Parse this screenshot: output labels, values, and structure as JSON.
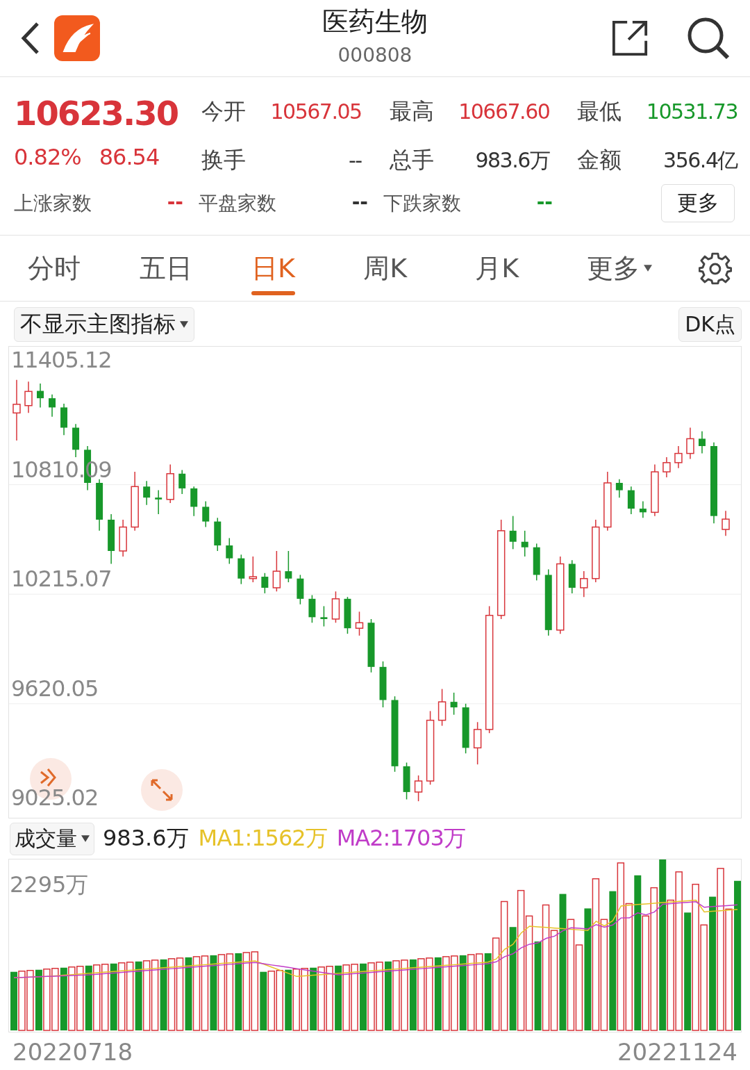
{
  "header": {
    "title": "医药生物",
    "code": "000808"
  },
  "quote": {
    "price": "10623.30",
    "change_pct": "0.82%",
    "change": "86.54",
    "color": "#d8343a",
    "stats": [
      {
        "label": "今开",
        "value": "10567.05",
        "color": "#d8343a"
      },
      {
        "label": "最高",
        "value": "10667.60",
        "color": "#d8343a"
      },
      {
        "label": "最低",
        "value": "10531.73",
        "color": "#17982a"
      },
      {
        "label": "换手",
        "value": "--",
        "color": "#333333"
      },
      {
        "label": "总手",
        "value": "983.6万",
        "color": "#333333"
      },
      {
        "label": "金额",
        "value": "356.4亿",
        "color": "#333333"
      }
    ],
    "breadth": [
      {
        "label": "上涨家数",
        "value": "--",
        "color": "#d8343a"
      },
      {
        "label": "平盘家数",
        "value": "--",
        "color": "#333333"
      },
      {
        "label": "下跌家数",
        "value": "--",
        "color": "#17982a"
      }
    ],
    "more_button": "更多"
  },
  "tabs": [
    {
      "label": "分时",
      "selected": false,
      "caret": false
    },
    {
      "label": "五日",
      "selected": false,
      "caret": false
    },
    {
      "label": "日K",
      "selected": true,
      "caret": false
    },
    {
      "label": "周K",
      "selected": false,
      "caret": false
    },
    {
      "label": "月K",
      "selected": false,
      "caret": false
    },
    {
      "label": "更多",
      "selected": false,
      "caret": true
    }
  ],
  "indicator_select": "不显示主图指标",
  "dk_button": "DK点",
  "price_chart": {
    "chart_data": {
      "type": "candlestick",
      "grid": true,
      "ylim": [
        9000,
        11560
      ],
      "yticks": [
        {
          "value": 11405.12,
          "label": "11405.12"
        },
        {
          "value": 10810.09,
          "label": "10810.09"
        },
        {
          "value": 10215.07,
          "label": "10215.07"
        },
        {
          "value": 9620.05,
          "label": "9620.05"
        },
        {
          "value": 9025.02,
          "label": "9025.02"
        }
      ],
      "ohlc": [
        [
          11200,
          11380,
          11050,
          11247
        ],
        [
          11240,
          11370,
          11200,
          11317
        ],
        [
          11320,
          11360,
          11230,
          11280
        ],
        [
          11280,
          11300,
          11180,
          11230
        ],
        [
          11230,
          11250,
          11080,
          11120
        ],
        [
          11120,
          11140,
          10960,
          11000
        ],
        [
          11000,
          11020,
          10780,
          10820
        ],
        [
          10820,
          10840,
          10560,
          10620
        ],
        [
          10620,
          10650,
          10380,
          10450
        ],
        [
          10450,
          10620,
          10420,
          10580
        ],
        [
          10580,
          10880,
          10560,
          10800
        ],
        [
          10800,
          10830,
          10700,
          10740
        ],
        [
          10740,
          10780,
          10650,
          10730
        ],
        [
          10730,
          10920,
          10710,
          10870
        ],
        [
          10870,
          10890,
          10760,
          10790
        ],
        [
          10790,
          10800,
          10640,
          10690
        ],
        [
          10690,
          10720,
          10580,
          10610
        ],
        [
          10610,
          10630,
          10450,
          10480
        ],
        [
          10480,
          10520,
          10380,
          10410
        ],
        [
          10410,
          10430,
          10270,
          10300
        ],
        [
          10300,
          10420,
          10280,
          10310
        ],
        [
          10310,
          10330,
          10220,
          10250
        ],
        [
          10250,
          10450,
          10230,
          10340
        ],
        [
          10340,
          10450,
          10280,
          10300
        ],
        [
          10300,
          10320,
          10160,
          10190
        ],
        [
          10190,
          10210,
          10060,
          10090
        ],
        [
          10090,
          10150,
          10040,
          10080
        ],
        [
          10080,
          10230,
          10060,
          10190
        ],
        [
          10190,
          10200,
          10000,
          10030
        ],
        [
          10030,
          10120,
          9990,
          10060
        ],
        [
          10060,
          10080,
          9790,
          9820
        ],
        [
          9820,
          9850,
          9600,
          9640
        ],
        [
          9640,
          9660,
          9250,
          9280
        ],
        [
          9280,
          9300,
          9100,
          9140
        ],
        [
          9140,
          9230,
          9090,
          9200
        ],
        [
          9200,
          9580,
          9180,
          9530
        ],
        [
          9530,
          9700,
          9500,
          9630
        ],
        [
          9630,
          9680,
          9560,
          9600
        ],
        [
          9600,
          9620,
          9350,
          9380
        ],
        [
          9380,
          9520,
          9290,
          9480
        ],
        [
          9480,
          10150,
          9460,
          10100
        ],
        [
          10100,
          10620,
          10080,
          10560
        ],
        [
          10560,
          10640,
          10460,
          10500
        ],
        [
          10500,
          10560,
          10420,
          10470
        ],
        [
          10470,
          10490,
          10290,
          10320
        ],
        [
          10320,
          10350,
          9990,
          10020
        ],
        [
          10020,
          10420,
          10000,
          10380
        ],
        [
          10380,
          10400,
          10220,
          10250
        ],
        [
          10250,
          10340,
          10200,
          10300
        ],
        [
          10300,
          10620,
          10280,
          10580
        ],
        [
          10580,
          10880,
          10560,
          10820
        ],
        [
          10820,
          10840,
          10740,
          10780
        ],
        [
          10780,
          10800,
          10650,
          10680
        ],
        [
          10680,
          10720,
          10630,
          10660
        ],
        [
          10660,
          10920,
          10640,
          10880
        ],
        [
          10880,
          10960,
          10850,
          10930
        ],
        [
          10930,
          11020,
          10900,
          10980
        ],
        [
          10980,
          11120,
          10950,
          11060
        ],
        [
          11060,
          11100,
          10980,
          11020
        ],
        [
          11020,
          11040,
          10600,
          10640
        ],
        [
          10567,
          10668,
          10532,
          10623
        ]
      ]
    }
  },
  "volume": {
    "selector": "成交量",
    "value": "983.6万",
    "y_label": "2295万",
    "ma": [
      {
        "label": "MA1:1562万",
        "color": "#e6c229"
      },
      {
        "label": "MA2:1703万",
        "color": "#c03cc8"
      }
    ]
  },
  "dates": {
    "start": "20220718",
    "end": "20221124"
  }
}
